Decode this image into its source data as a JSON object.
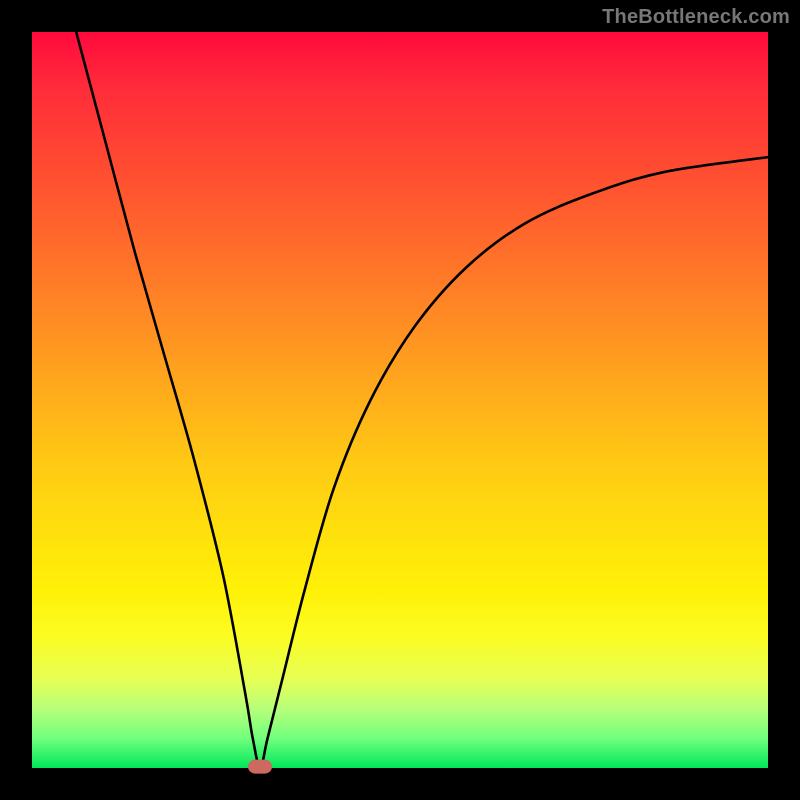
{
  "watermark": {
    "text": "TheBottleneck.com"
  },
  "colors": {
    "page_bg": "#000000",
    "curve_stroke": "#000000",
    "marker_fill": "#cc6a61",
    "gradient_top": "#ff0a3c",
    "gradient_bottom": "#00e85a"
  },
  "chart_data": {
    "type": "line",
    "title": "",
    "xlabel": "",
    "ylabel": "",
    "xlim": [
      0,
      100
    ],
    "ylim": [
      0,
      100
    ],
    "grid": false,
    "annotations": [
      {
        "name": "optimal-marker",
        "x": 31,
        "y": 0
      }
    ],
    "series": [
      {
        "name": "bottleneck-curve",
        "x": [
          6,
          10,
          14,
          18,
          22,
          26,
          29,
          30,
          31,
          32,
          34,
          37,
          41,
          46,
          52,
          59,
          67,
          76,
          86,
          100
        ],
        "values": [
          100,
          85,
          70,
          56,
          42,
          26,
          10,
          4,
          0,
          4,
          12,
          24,
          38,
          50,
          60,
          68,
          74,
          78,
          81,
          83
        ]
      }
    ]
  }
}
